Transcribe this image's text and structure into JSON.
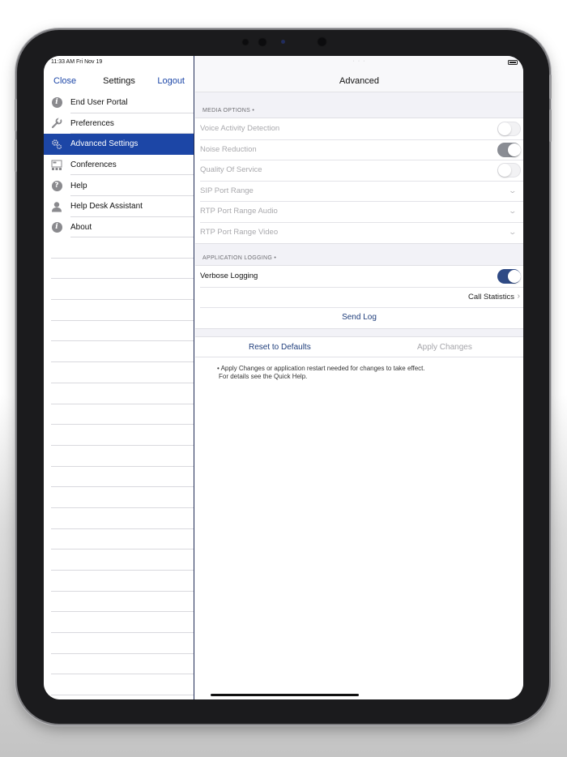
{
  "status_bar": {
    "time_date": "11:33 AM  Fri Nov 19",
    "multitask_dots": "· · ·"
  },
  "left_nav": {
    "close_label": "Close",
    "title": "Settings",
    "logout_label": "Logout"
  },
  "menu": [
    {
      "label": "End User Portal",
      "icon": "info-icon"
    },
    {
      "label": "Preferences",
      "icon": "wrench-icon"
    },
    {
      "label": "Advanced Settings",
      "icon": "gears-icon",
      "selected": true
    },
    {
      "label": "Conferences",
      "icon": "conference-icon"
    },
    {
      "label": "Help",
      "icon": "help-icon"
    },
    {
      "label": "Help Desk Assistant",
      "icon": "person-icon"
    },
    {
      "label": "About",
      "icon": "info-icon"
    }
  ],
  "right_nav": {
    "title": "Advanced"
  },
  "media_options": {
    "header": "MEDIA OPTIONS •",
    "rows": [
      {
        "label": "Voice Activity Detection",
        "control": "toggle",
        "on": false
      },
      {
        "label": "Noise Reduction",
        "control": "toggle",
        "on": true
      },
      {
        "label": "Quality Of Service",
        "control": "toggle",
        "on": false
      },
      {
        "label": "SIP Port Range",
        "control": "chevron"
      },
      {
        "label": "RTP Port Range Audio",
        "control": "chevron"
      },
      {
        "label": "RTP Port Range Video",
        "control": "chevron"
      }
    ]
  },
  "application_logging": {
    "header": "APPLICATION LOGGING •",
    "verbose_label": "Verbose Logging",
    "verbose_on": true,
    "call_statistics_label": "Call Statistics",
    "send_log_label": "Send Log"
  },
  "actions": {
    "reset_label": "Reset to Defaults",
    "apply_label": "Apply Changes"
  },
  "note": {
    "line1": "• Apply Changes or application restart needed for changes to take effect.",
    "line2": "For details see the Quick Help."
  },
  "colors": {
    "accent": "#1c46a6",
    "link": "#1e3d7b",
    "toggle_on": "#2f4a85"
  }
}
